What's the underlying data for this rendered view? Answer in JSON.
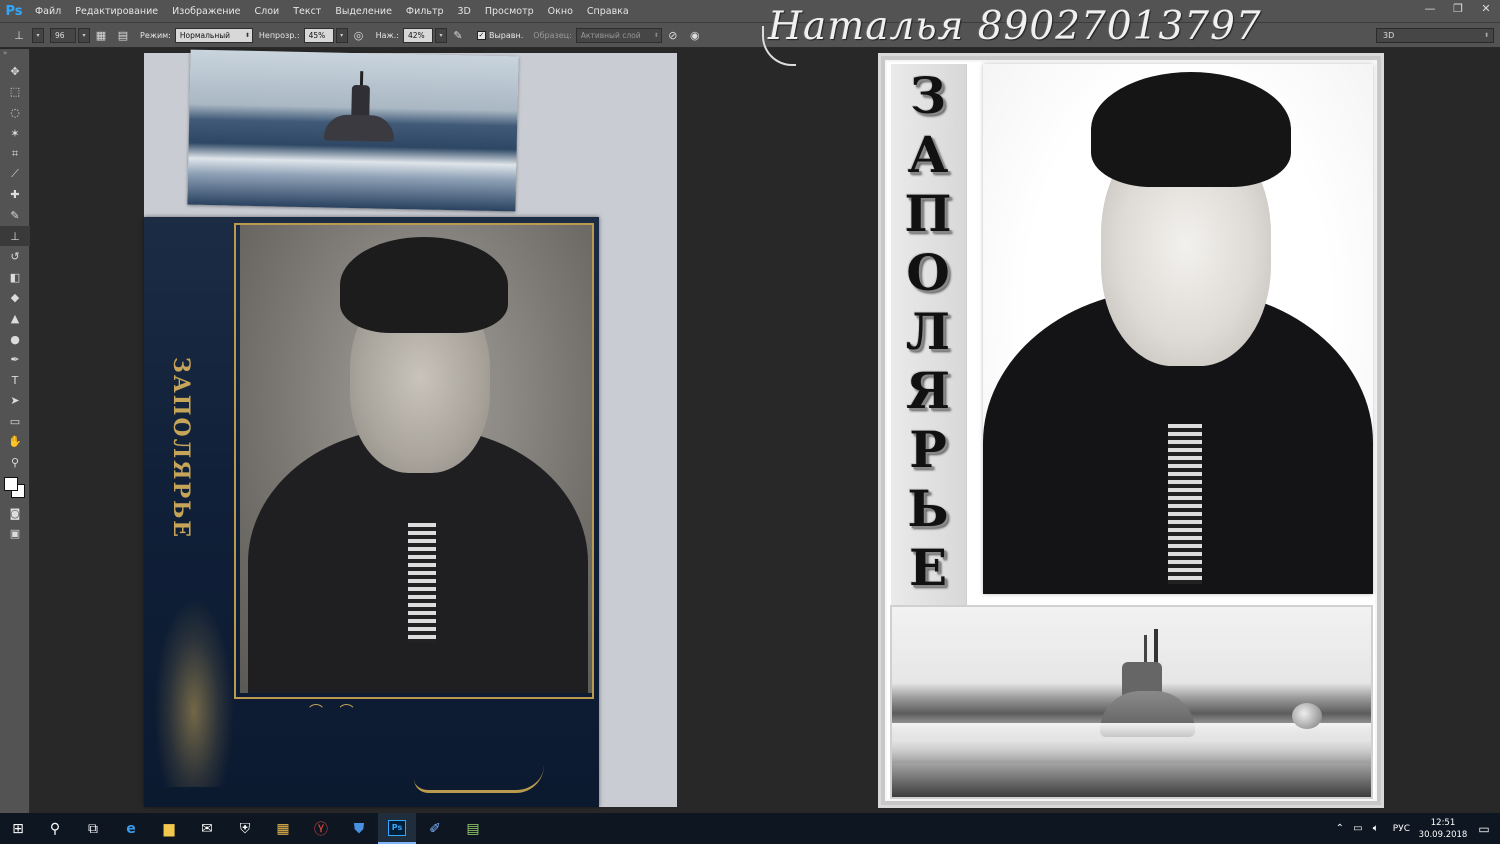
{
  "app": {
    "logo": "Ps"
  },
  "menu": [
    "Файл",
    "Редактирование",
    "Изображение",
    "Слои",
    "Текст",
    "Выделение",
    "Фильтр",
    "3D",
    "Просмотр",
    "Окно",
    "Справка"
  ],
  "window_controls": [
    "—",
    "❐",
    "✕"
  ],
  "options": {
    "brush_size": "96",
    "mode_label": "Режим:",
    "mode_value": "Нормальный",
    "opacity_label": "Непрозр.:",
    "opacity_value": "45%",
    "flow_label": "Наж.:",
    "flow_value": "42%",
    "aligned_label": "Выравн.",
    "sample_label": "Образец:",
    "sample_value": "Активный слой",
    "workspace_value": "3D"
  },
  "watermark": {
    "text": "Наталья 89027013797"
  },
  "tools": [
    "move-tool",
    "marquee-tool",
    "lasso-tool",
    "magic-wand-tool",
    "crop-tool",
    "eyedropper-tool",
    "healing-tool",
    "brush-tool",
    "clone-stamp-tool",
    "history-brush-tool",
    "eraser-tool",
    "paint-bucket-tool",
    "blur-tool",
    "dodge-tool",
    "pen-tool",
    "type-tool",
    "path-select-tool",
    "rectangle-tool",
    "hand-tool",
    "zoom-tool"
  ],
  "document": {
    "folder_text": "ЗАПОЛЯРЬЕ",
    "title_letters": [
      "З",
      "А",
      "П",
      "О",
      "Л",
      "Я",
      "Р",
      "Ь",
      "Е"
    ]
  },
  "taskbar": {
    "language": "РУС",
    "time": "12:51",
    "date": "30.09.2018"
  },
  "colors": {
    "ps_blue": "#31a8ff",
    "ui_gray": "#535353",
    "canvas_bg": "#282828",
    "gold": "#c6a559"
  }
}
